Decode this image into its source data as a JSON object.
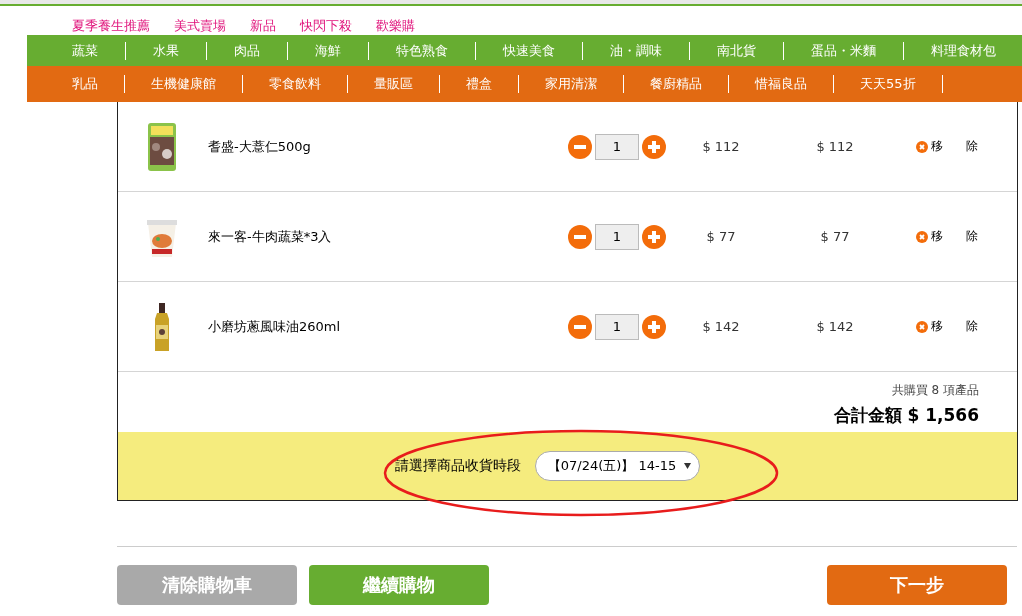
{
  "top_links": [
    "夏季養生推薦",
    "美式賣場",
    "新品",
    "快閃下殺",
    "歡樂購"
  ],
  "category_rows": [
    {
      "color": "#67ad31",
      "items": [
        "蔬菜",
        "水果",
        "肉品",
        "海鮮",
        "特色熟食",
        "快速美食",
        "油・調味",
        "南北貨",
        "蛋品・米麵",
        "料理食材包"
      ]
    },
    {
      "color": "#e26a12",
      "items": [
        "乳品",
        "生機健康館",
        "零食飲料",
        "量販區",
        "禮盒",
        "家用清潔",
        "餐廚精品",
        "惜福良品",
        "天天55折"
      ]
    }
  ],
  "cart_items": [
    {
      "kind": "bag",
      "name": "耆盛-大薏仁500g",
      "quantity": "1",
      "price": "$ 112",
      "subtotal": "$ 112",
      "remove": "移除"
    },
    {
      "kind": "cup",
      "name": "來一客-牛肉蔬菜*3入",
      "quantity": "1",
      "price": "$ 77",
      "subtotal": "$ 77",
      "remove": "移除"
    },
    {
      "kind": "bottle",
      "name": "小磨坊蔥風味油260ml",
      "quantity": "1",
      "price": "$ 142",
      "subtotal": "$ 142",
      "remove": "移除"
    }
  ],
  "summary": {
    "count": "共購買 8 項產品",
    "total": "合計金額 $ 1,566"
  },
  "delivery": {
    "label": "請選擇商品收貨時段",
    "value": "【07/24(五)】 14-15",
    "highlighted": true
  },
  "buttons": [
    {
      "kind": "clear",
      "label": "清除購物車"
    },
    {
      "kind": "continue",
      "label": "繼續購物"
    },
    {
      "kind": "next",
      "label": "下一步"
    }
  ]
}
